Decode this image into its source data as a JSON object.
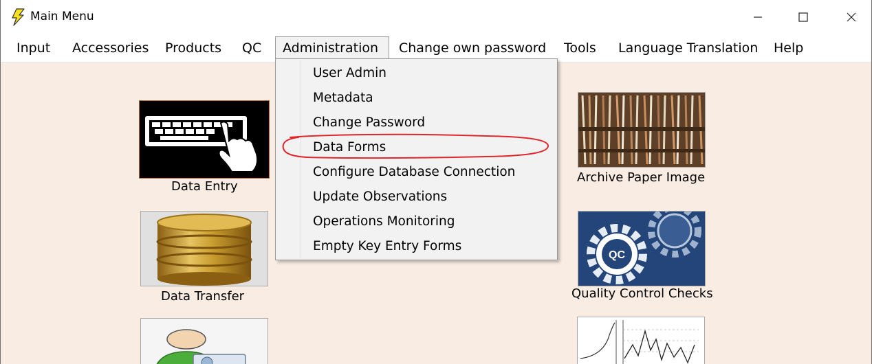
{
  "window": {
    "title": "Main Menu",
    "icon": "lightning-bolt-icon"
  },
  "menubar": {
    "items": [
      {
        "label": "Input"
      },
      {
        "label": "Accessories"
      },
      {
        "label": "Products"
      },
      {
        "label": "QC"
      },
      {
        "label": "Administration"
      },
      {
        "label": "Change own password"
      },
      {
        "label": "Tools"
      },
      {
        "label": "Language Translation"
      },
      {
        "label": "Help"
      }
    ],
    "active_index": 4
  },
  "administration_menu": {
    "items": [
      {
        "label": "User Admin"
      },
      {
        "label": "Metadata"
      },
      {
        "label": "Change Password"
      },
      {
        "label": "Data Forms"
      },
      {
        "label": "Configure Database Connection"
      },
      {
        "label": "Update Observations"
      },
      {
        "label": "Operations Monitoring"
      },
      {
        "label": "Empty Key Entry Forms"
      }
    ],
    "annotated_item": "Data Forms",
    "annotation_color": "#e0262a"
  },
  "tiles": {
    "data_entry": {
      "label": "Data Entry",
      "icon": "keyboard-hand-icon"
    },
    "data_transfer": {
      "label": "Data Transfer",
      "icon": "database-icon"
    },
    "user_tile": {
      "label": "",
      "icon": "user-icon"
    },
    "archive_paper_image": {
      "label": "Archive Paper Image",
      "icon": "paper-archive-icon"
    },
    "quality_control_checks": {
      "label": "Quality Control Checks",
      "icon": "qc-gears-icon"
    },
    "chart_tile": {
      "label": "",
      "icon": "line-chart-icon"
    }
  },
  "colors": {
    "background": "#f8ece3",
    "qc_blue": "#23457a",
    "database_gold": "#c79b2e"
  }
}
